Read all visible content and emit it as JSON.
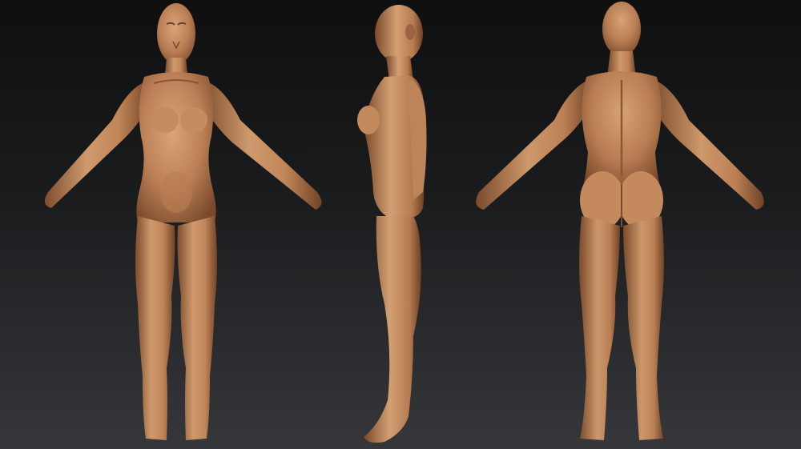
{
  "scene": {
    "subject": "",
    "views": [
      {
        "id": "front",
        "icon": "front-view-figure-icon"
      },
      {
        "id": "side",
        "icon": "side-view-figure-icon"
      },
      {
        "id": "back",
        "icon": "back-view-figure-icon"
      }
    ],
    "colors": {
      "skin_light": "#d19a6c",
      "skin_mid": "#b47850",
      "skin_shadow": "#6e4327",
      "background_top": "#0f0f10",
      "background_bottom": "#36373a"
    }
  }
}
